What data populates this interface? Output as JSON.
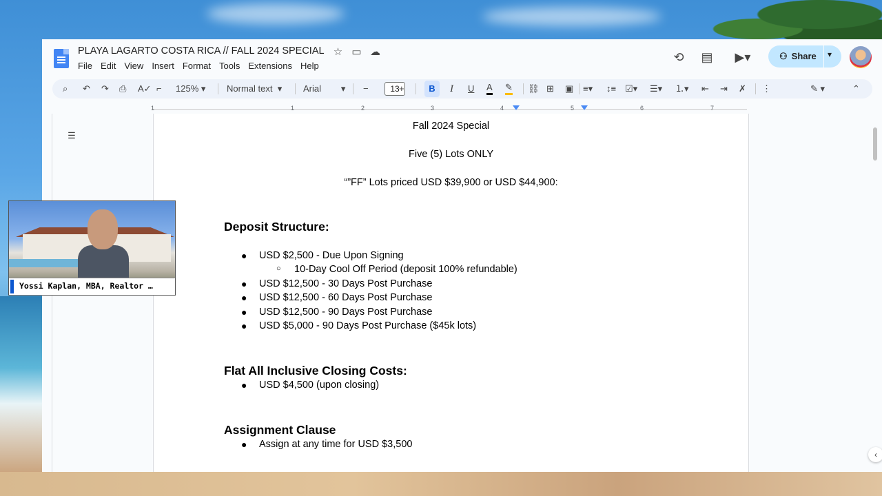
{
  "document": {
    "title": "PLAYA LAGARTO COSTA RICA // FALL 2024 SPECIAL"
  },
  "menu": [
    "File",
    "Edit",
    "View",
    "Insert",
    "Format",
    "Tools",
    "Extensions",
    "Help"
  ],
  "header": {
    "share_label": "Share"
  },
  "toolbar": {
    "zoom": "125%",
    "style": "Normal text",
    "font": "Arial",
    "font_size": "13",
    "bold_label": "B",
    "italic_label": "I",
    "underline_label": "U",
    "text_color_label": "A",
    "minus_label": "−",
    "plus_label": "+"
  },
  "ruler": [
    "1",
    "1",
    "2",
    "3",
    "4",
    "5",
    "6",
    "7"
  ],
  "content": {
    "line1": "Fall 2024 Special",
    "line2": "Five (5) Lots ONLY",
    "line3": "“”FF” Lots priced USD $39,900 or USD $44,900:",
    "deposit_heading": "Deposit Structure:",
    "deposit_items": [
      "USD $2,500 - Due Upon Signing",
      "10-Day Cool Off Period (deposit 100% refundable)",
      "USD $12,500 - 30 Days Post Purchase",
      "USD $12,500 - 60 Days Post Purchase",
      "USD $12,500 - 90 Days Post Purchase",
      "USD $5,000 - 90 Days Post Purchase ($45k lots)"
    ],
    "closing_heading": "Flat All Inclusive Closing Costs:",
    "closing_item": "USD $4,500 (upon closing)",
    "assignment_heading": "Assignment Clause",
    "assignment_item": "Assign at any time for USD $3,500"
  },
  "video": {
    "name": "Yossi Kaplan, MBA, Realtor …"
  }
}
